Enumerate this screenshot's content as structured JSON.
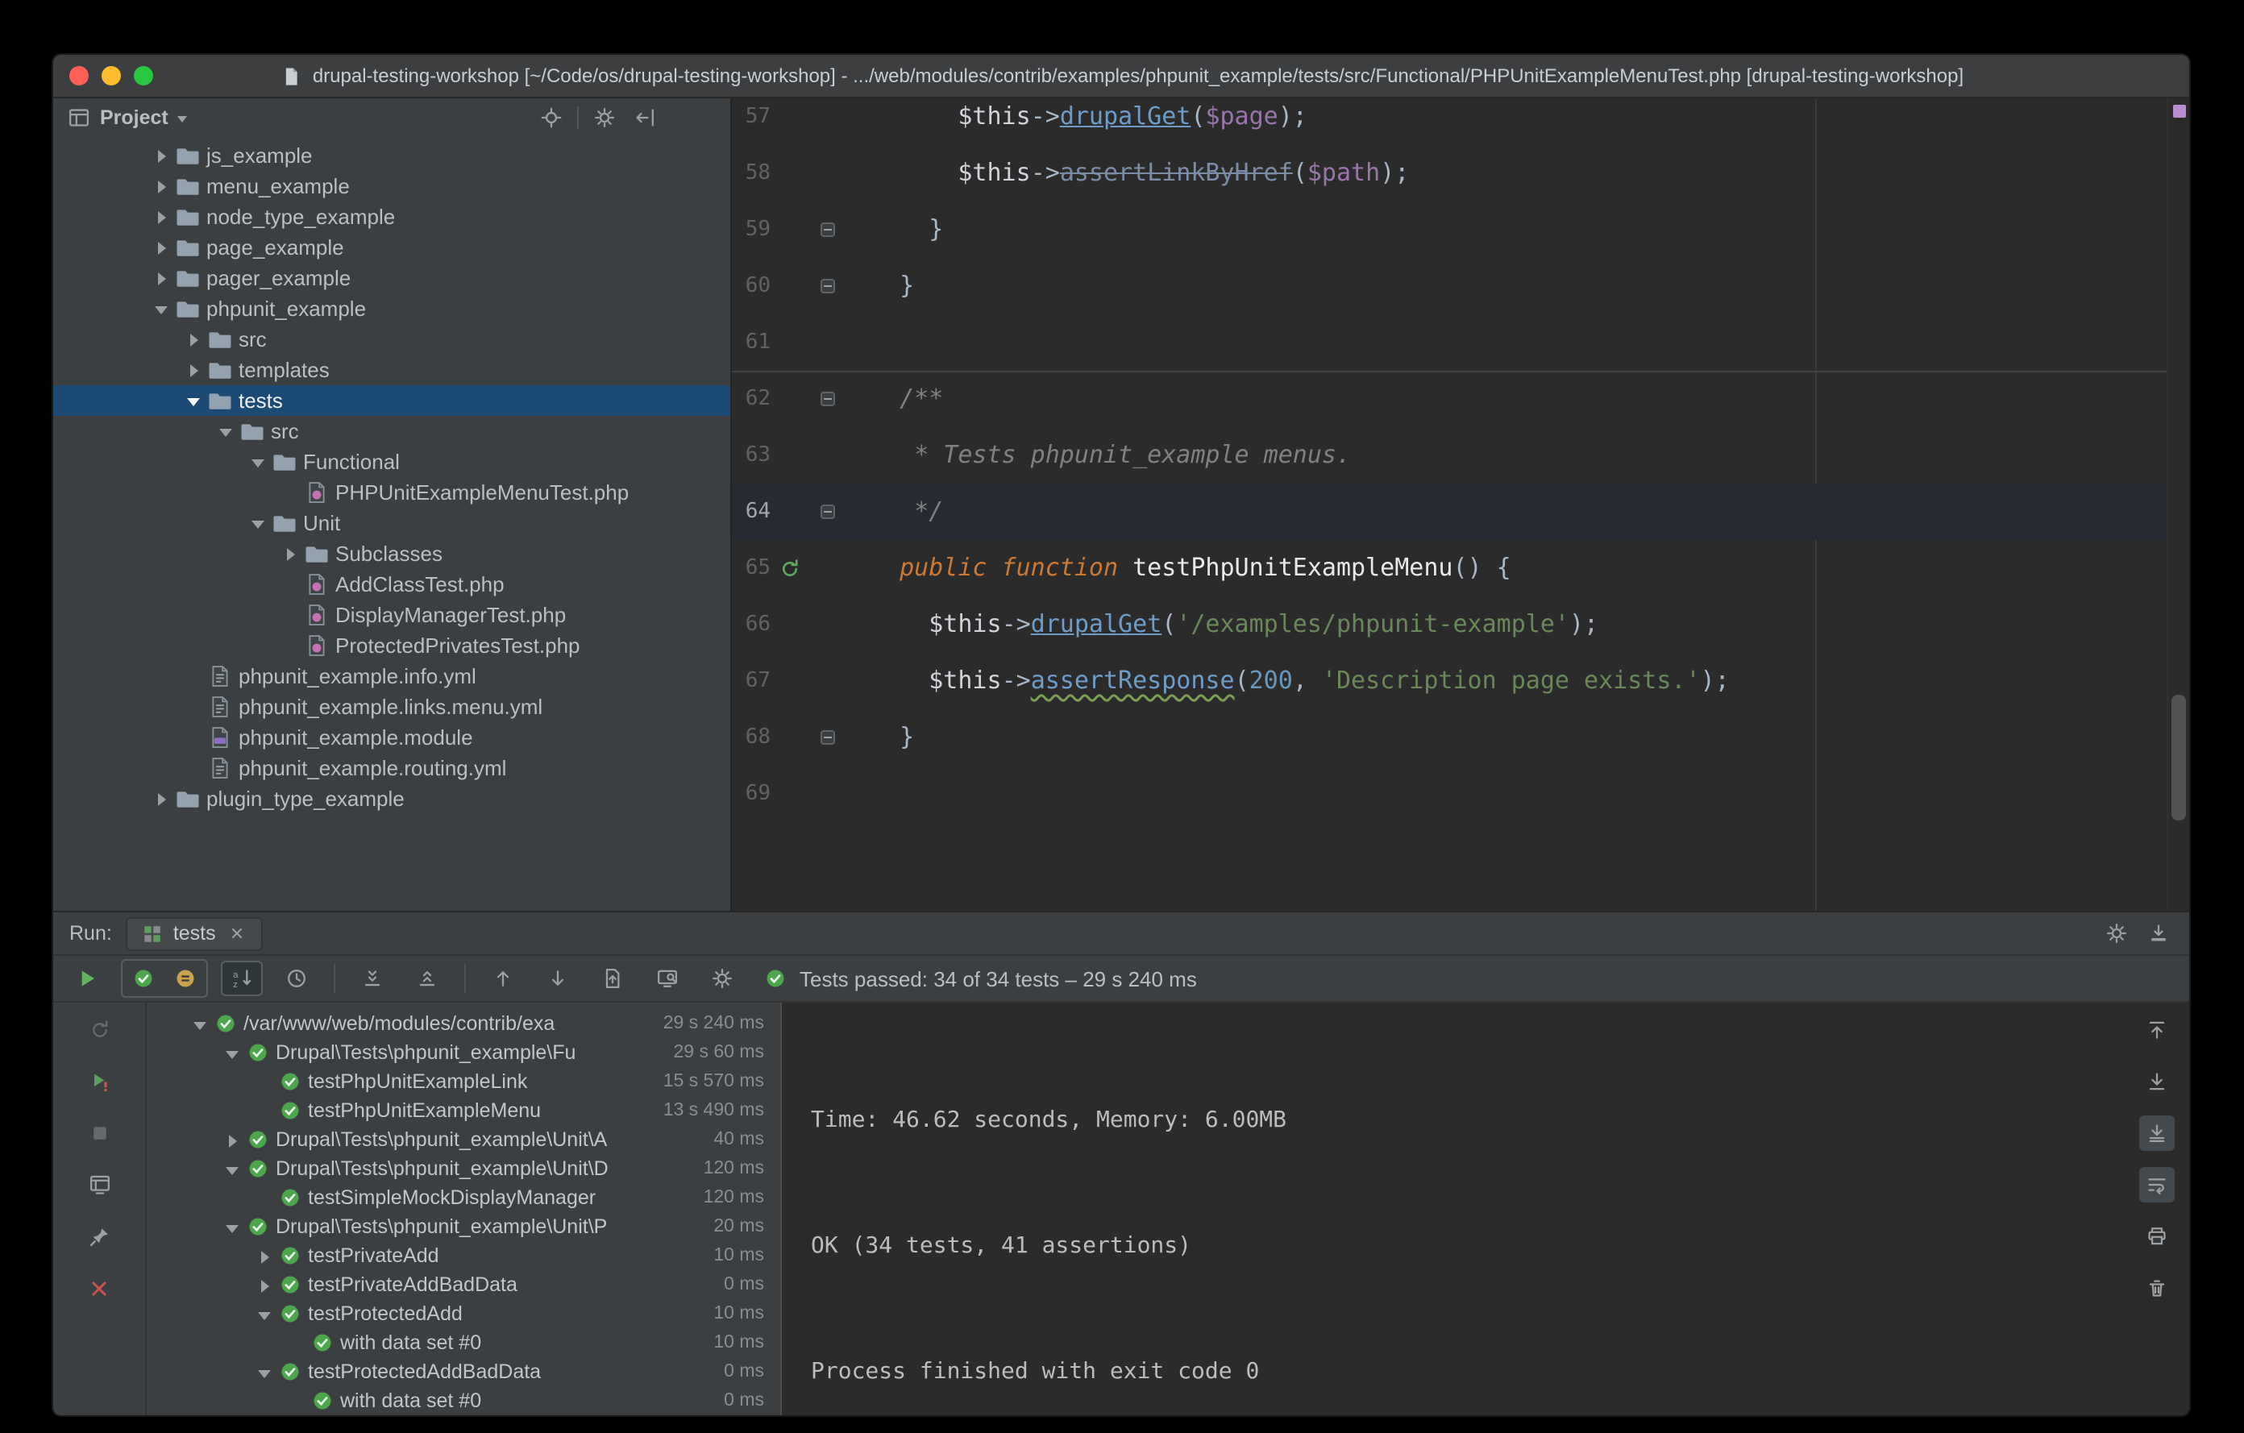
{
  "colors": {
    "selection_blue": "#1D4A74",
    "passed_green": "#4CA64C",
    "run_green": "#63B35F",
    "error_red": "#C75450",
    "editor_bg": "#2b2b2b",
    "panel_bg": "#3c3f41",
    "stripe_mark_purple": "#BA8FD0"
  },
  "window": {
    "title": "drupal-testing-workshop [~/Code/os/drupal-testing-workshop] - .../web/modules/contrib/examples/phpunit_example/tests/src/Functional/PHPUnitExampleMenuTest.php [drupal-testing-workshop]"
  },
  "project_panel": {
    "title": "Project",
    "view_icon": "project-view-icon",
    "header_icons": [
      "locate-file-icon",
      "divider",
      "settings-gear-icon",
      "hide-panel-icon"
    ],
    "tree": [
      {
        "label": "js_example",
        "level": 0,
        "arrow": "closed",
        "icon": "folder"
      },
      {
        "label": "menu_example",
        "level": 0,
        "arrow": "closed",
        "icon": "folder"
      },
      {
        "label": "node_type_example",
        "level": 0,
        "arrow": "closed",
        "icon": "folder"
      },
      {
        "label": "page_example",
        "level": 0,
        "arrow": "closed",
        "icon": "folder"
      },
      {
        "label": "pager_example",
        "level": 0,
        "arrow": "closed",
        "icon": "folder"
      },
      {
        "label": "phpunit_example",
        "level": 0,
        "arrow": "open",
        "icon": "folder"
      },
      {
        "label": "src",
        "level": 1,
        "arrow": "closed",
        "icon": "folder"
      },
      {
        "label": "templates",
        "level": 1,
        "arrow": "closed",
        "icon": "folder"
      },
      {
        "label": "tests",
        "level": 1,
        "arrow": "open",
        "icon": "folder",
        "selected": true
      },
      {
        "label": "src",
        "level": 2,
        "arrow": "open",
        "icon": "folder"
      },
      {
        "label": "Functional",
        "level": 3,
        "arrow": "open",
        "icon": "folder"
      },
      {
        "label": "PHPUnitExampleMenuTest.php",
        "level": 4,
        "arrow": "none",
        "icon": "php-file"
      },
      {
        "label": "Unit",
        "level": 3,
        "arrow": "open",
        "icon": "folder"
      },
      {
        "label": "Subclasses",
        "level": 4,
        "arrow": "closed",
        "icon": "folder"
      },
      {
        "label": "AddClassTest.php",
        "level": 4,
        "arrow": "none",
        "icon": "php-file"
      },
      {
        "label": "DisplayManagerTest.php",
        "level": 4,
        "arrow": "none",
        "icon": "php-file"
      },
      {
        "label": "ProtectedPrivatesTest.php",
        "level": 4,
        "arrow": "none",
        "icon": "php-file"
      },
      {
        "label": "phpunit_example.info.yml",
        "level": 1,
        "arrow": "none",
        "icon": "yml-file"
      },
      {
        "label": "phpunit_example.links.menu.yml",
        "level": 1,
        "arrow": "none",
        "icon": "yml-file"
      },
      {
        "label": "phpunit_example.module",
        "level": 1,
        "arrow": "none",
        "icon": "module-file"
      },
      {
        "label": "phpunit_example.routing.yml",
        "level": 1,
        "arrow": "none",
        "icon": "yml-file"
      },
      {
        "label": "plugin_type_example",
        "level": 0,
        "arrow": "closed",
        "icon": "folder"
      }
    ]
  },
  "editor": {
    "lines": [
      {
        "num": "57",
        "segs": [
          [
            "p",
            "      "
          ],
          [
            "t",
            "$this"
          ],
          [
            "p",
            "->"
          ],
          [
            "m",
            "drupalGet"
          ],
          [
            "p",
            "("
          ],
          [
            "v",
            "$page"
          ],
          [
            "p",
            ");"
          ]
        ]
      },
      {
        "num": "58",
        "segs": [
          [
            "p",
            "      "
          ],
          [
            "t",
            "$this"
          ],
          [
            "p",
            "->"
          ],
          [
            "ms",
            "assertLinkByHref"
          ],
          [
            "p",
            "("
          ],
          [
            "v",
            "$path"
          ],
          [
            "p",
            ");"
          ]
        ]
      },
      {
        "num": "59",
        "fold": true,
        "segs": [
          [
            "p",
            "    }"
          ]
        ]
      },
      {
        "num": "60",
        "fold": true,
        "segs": [
          [
            "p",
            "  }"
          ]
        ]
      },
      {
        "num": "61",
        "segs": []
      },
      {
        "num": "62",
        "fold": true,
        "sep": true,
        "segs": [
          [
            "p",
            "  "
          ],
          [
            "c",
            "/**"
          ]
        ]
      },
      {
        "num": "63",
        "segs": [
          [
            "p",
            "   "
          ],
          [
            "c",
            "* Tests phpunit_example menus."
          ]
        ]
      },
      {
        "num": "64",
        "fold": true,
        "current": true,
        "segs": [
          [
            "p",
            "   "
          ],
          [
            "c",
            "*/"
          ]
        ]
      },
      {
        "num": "65",
        "run": true,
        "segs": [
          [
            "p",
            "  "
          ],
          [
            "k",
            "public function"
          ],
          [
            "p",
            " "
          ],
          [
            "f",
            "testPhpUnitExampleMenu"
          ],
          [
            "p",
            "() {"
          ]
        ]
      },
      {
        "num": "66",
        "segs": [
          [
            "p",
            "    "
          ],
          [
            "t",
            "$this"
          ],
          [
            "p",
            "->"
          ],
          [
            "m",
            "drupalGet"
          ],
          [
            "p",
            "("
          ],
          [
            "s",
            "'/examples/phpunit-example'"
          ],
          [
            "p",
            ");"
          ]
        ]
      },
      {
        "num": "67",
        "segs": [
          [
            "p",
            "    "
          ],
          [
            "t",
            "$this"
          ],
          [
            "p",
            "->"
          ],
          [
            "mw",
            "assertResponse"
          ],
          [
            "p",
            "("
          ],
          [
            "n",
            "200"
          ],
          [
            "p",
            ", "
          ],
          [
            "s",
            "'Description page exists.'"
          ],
          [
            "p",
            ");"
          ]
        ]
      },
      {
        "num": "68",
        "fold": true,
        "segs": [
          [
            "p",
            "  }"
          ]
        ]
      },
      {
        "num": "69",
        "segs": []
      }
    ]
  },
  "run_panel": {
    "panel_label": "Run:",
    "tab_label": "tests",
    "tab_icon": "test-results-icon",
    "tab_strip_icons": [
      "settings-gear-icon",
      "dock-window-icon"
    ],
    "status_text": "Tests passed: 34 of 34 tests – 29 s 240 ms",
    "toolbar": [
      {
        "name": "rerun-tests-icon"
      },
      {
        "name": "show-passed-icon",
        "box": 1
      },
      {
        "name": "show-ignored-icon",
        "box": 1
      },
      {
        "name": "sort-alphabetically-icon",
        "pressed": true
      },
      {
        "name": "sort-by-duration-icon"
      },
      {
        "divider": true
      },
      {
        "name": "expand-all-icon"
      },
      {
        "name": "collapse-all-icon"
      },
      {
        "divider": true
      },
      {
        "name": "previous-failed-test-icon"
      },
      {
        "name": "next-failed-test-icon"
      },
      {
        "name": "export-test-results-icon"
      },
      {
        "name": "monitor-magnifier-icon"
      },
      {
        "name": "settings-gear-icon"
      }
    ],
    "left_strip": [
      {
        "name": "rerun-icon",
        "dim": true
      },
      {
        "name": "rerun-failed-tests-icon"
      },
      {
        "name": "stop-icon",
        "dim": true
      },
      {
        "name": "restore-layout-icon"
      },
      {
        "name": "pin-tab-icon"
      },
      {
        "name": "close-icon"
      }
    ],
    "right_strip": [
      {
        "name": "scroll-to-top-icon"
      },
      {
        "name": "scroll-to-bottom-icon"
      },
      {
        "name": "scroll-to-end-icon",
        "pressed": true
      },
      {
        "name": "soft-wrap-icon",
        "pressed": true
      },
      {
        "name": "print-icon"
      },
      {
        "name": "clear-all-icon"
      }
    ],
    "tree": [
      {
        "label": "/var/www/web/modules/contrib/exa",
        "duration": "29 s 240 ms",
        "level": 0,
        "arrow": "open",
        "status": "passed"
      },
      {
        "label": "Drupal\\Tests\\phpunit_example\\Fu",
        "duration": "29 s 60 ms",
        "level": 1,
        "arrow": "open",
        "status": "passed"
      },
      {
        "label": "testPhpUnitExampleLink",
        "duration": "15 s 570 ms",
        "level": 2,
        "arrow": "none",
        "status": "passed"
      },
      {
        "label": "testPhpUnitExampleMenu",
        "duration": "13 s 490 ms",
        "level": 2,
        "arrow": "none",
        "status": "passed"
      },
      {
        "label": "Drupal\\Tests\\phpunit_example\\Unit\\A",
        "duration": "40 ms",
        "level": 1,
        "arrow": "closed",
        "status": "passed"
      },
      {
        "label": "Drupal\\Tests\\phpunit_example\\Unit\\D",
        "duration": "120 ms",
        "level": 1,
        "arrow": "open",
        "status": "passed"
      },
      {
        "label": "testSimpleMockDisplayManager",
        "duration": "120 ms",
        "level": 2,
        "arrow": "none",
        "status": "passed"
      },
      {
        "label": "Drupal\\Tests\\phpunit_example\\Unit\\P",
        "duration": "20 ms",
        "level": 1,
        "arrow": "open",
        "status": "passed"
      },
      {
        "label": "testPrivateAdd",
        "duration": "10 ms",
        "level": 2,
        "arrow": "closed",
        "status": "passed"
      },
      {
        "label": "testPrivateAddBadData",
        "duration": "0 ms",
        "level": 2,
        "arrow": "closed",
        "status": "passed"
      },
      {
        "label": "testProtectedAdd",
        "duration": "10 ms",
        "level": 2,
        "arrow": "open",
        "status": "passed"
      },
      {
        "label": "with data set #0",
        "duration": "10 ms",
        "level": 3,
        "arrow": "none",
        "status": "passed"
      },
      {
        "label": "testProtectedAddBadData",
        "duration": "0 ms",
        "level": 2,
        "arrow": "open",
        "status": "passed"
      },
      {
        "label": "with data set #0",
        "duration": "0 ms",
        "level": 3,
        "arrow": "none",
        "status": "passed"
      }
    ],
    "console": [
      "Time: 46.62 seconds, Memory: 6.00MB",
      "OK (34 tests, 41 assertions)",
      "Process finished with exit code 0"
    ]
  }
}
